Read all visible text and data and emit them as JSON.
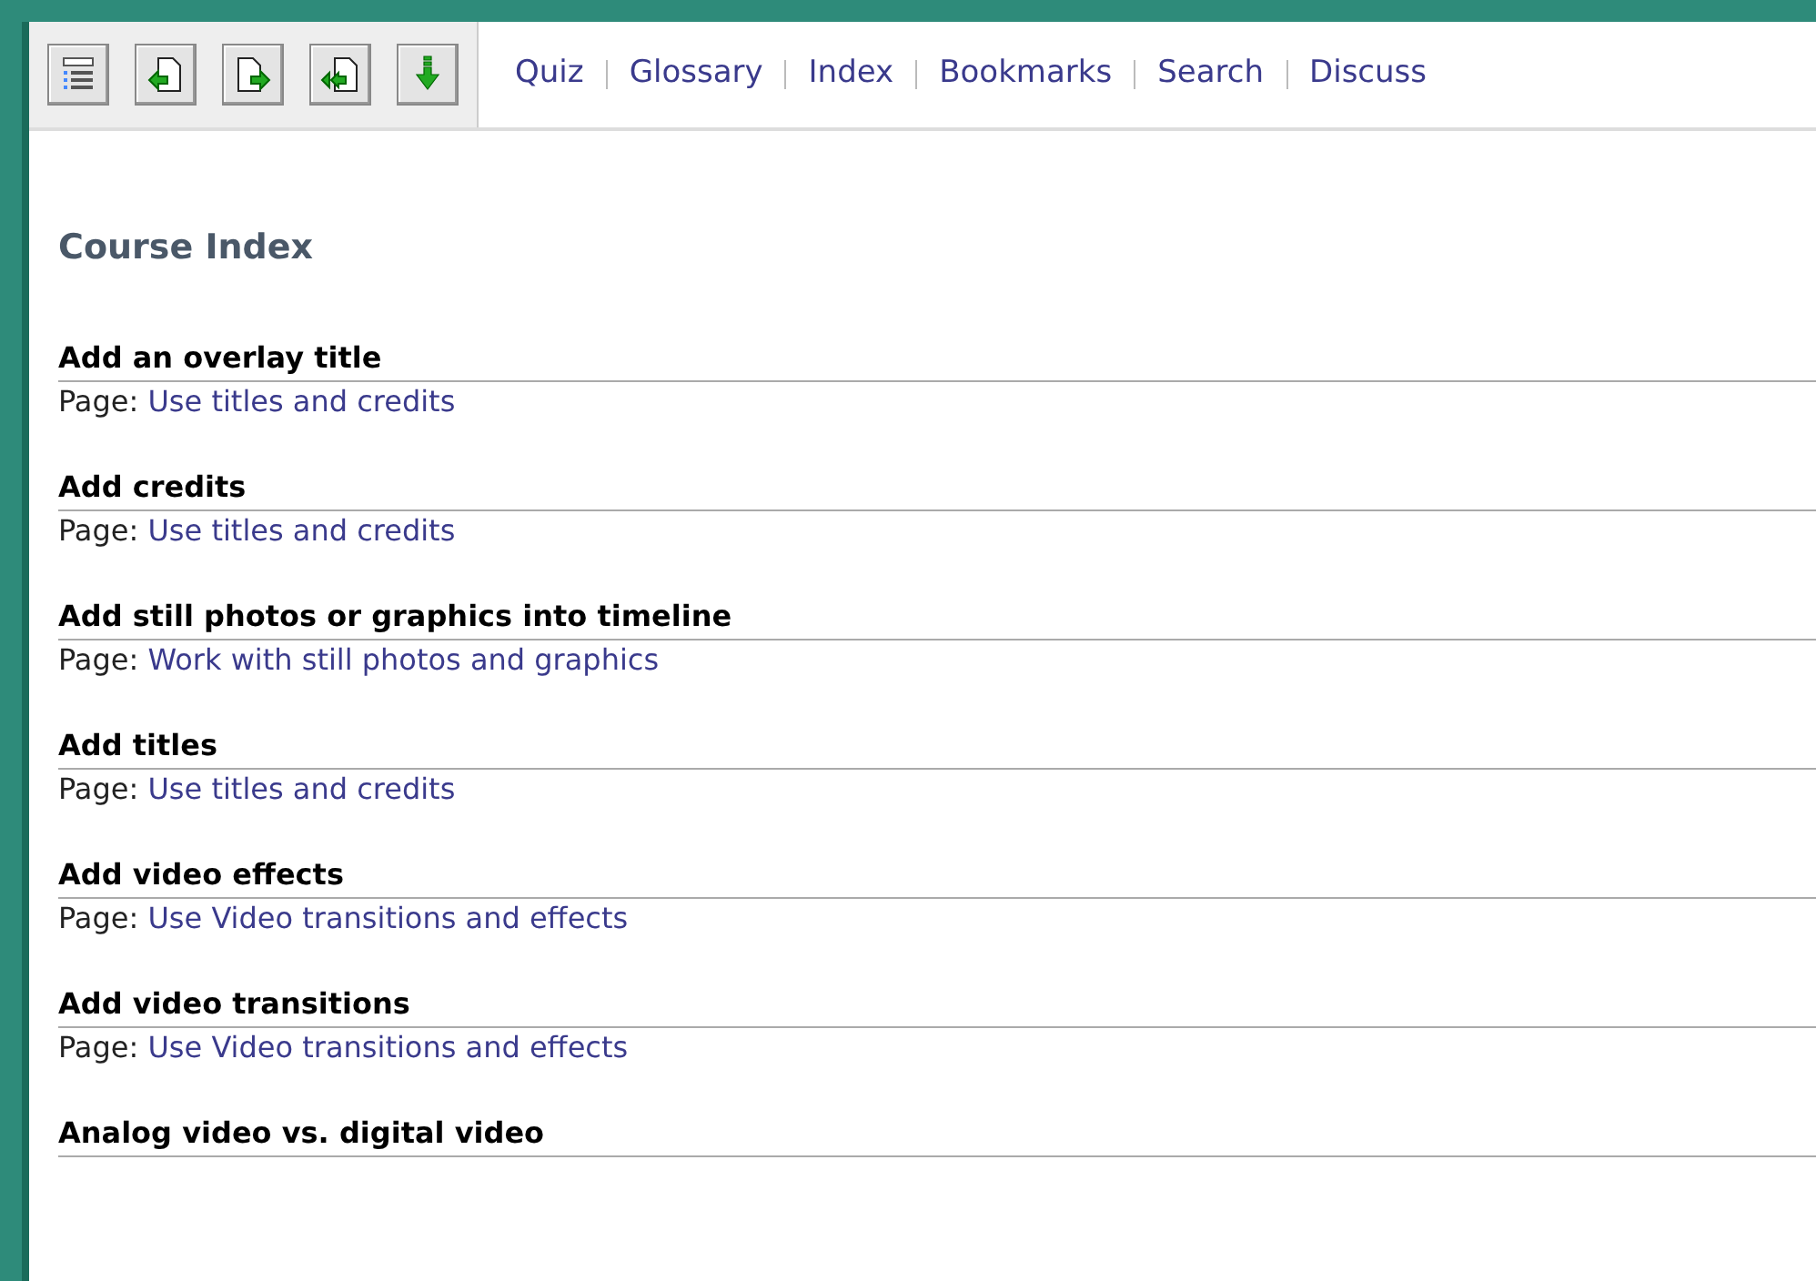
{
  "nav_links": [
    "Quiz",
    "Glossary",
    "Index",
    "Bookmarks",
    "Search",
    "Discuss"
  ],
  "heading": "Course Index",
  "entries": [
    {
      "topic": "Add an overlay title",
      "label": "Page:",
      "link": "Use titles and credits"
    },
    {
      "topic": "Add credits",
      "label": "Page:",
      "link": "Use titles and credits"
    },
    {
      "topic": "Add still photos or graphics into timeline",
      "label": "Page:",
      "link": "Work with still photos and graphics"
    },
    {
      "topic": "Add titles",
      "label": "Page:",
      "link": "Use titles and credits"
    },
    {
      "topic": "Add video effects",
      "label": "Page:",
      "link": "Use Video transitions and effects"
    },
    {
      "topic": "Add video transitions",
      "label": "Page:",
      "link": "Use Video transitions and effects"
    },
    {
      "topic": "Analog video vs. digital video"
    }
  ]
}
